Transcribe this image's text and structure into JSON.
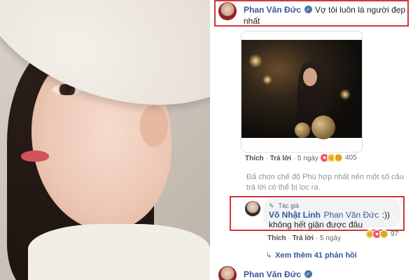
{
  "comment1": {
    "author": "Phan Văn Đức",
    "text": "Vợ tôi luôn là người đẹp nhất",
    "actions": {
      "like": "Thích",
      "reply": "Trả lời",
      "time": "5 ngày"
    },
    "reaction_count": "405"
  },
  "notice": "Đã chọn chế độ Phù hợp nhất nên một số câu trả lời có thể bị lọc ra.",
  "reply1": {
    "badge": "Tác giả",
    "author": "Võ Nhật Linh",
    "mention": "Phan Văn Đức",
    "text_suffix": ":))",
    "text_line2": "không hết giận được đâu",
    "actions": {
      "like": "Thích",
      "reply": "Trả lời",
      "time": "5 ngày"
    },
    "reaction_count": "97"
  },
  "view_more": "Xem thêm 41 phản hồi",
  "comment2": {
    "author": "Phan Văn Đức"
  },
  "colors": {
    "link": "#365899",
    "highlight": "#d0363d",
    "bubble": "#f2f3f5"
  },
  "icons": [
    "verified-icon",
    "love-reaction-icon",
    "haha-reaction-icon",
    "sad-reaction-icon",
    "pencil-icon",
    "reply-arrow-icon"
  ]
}
